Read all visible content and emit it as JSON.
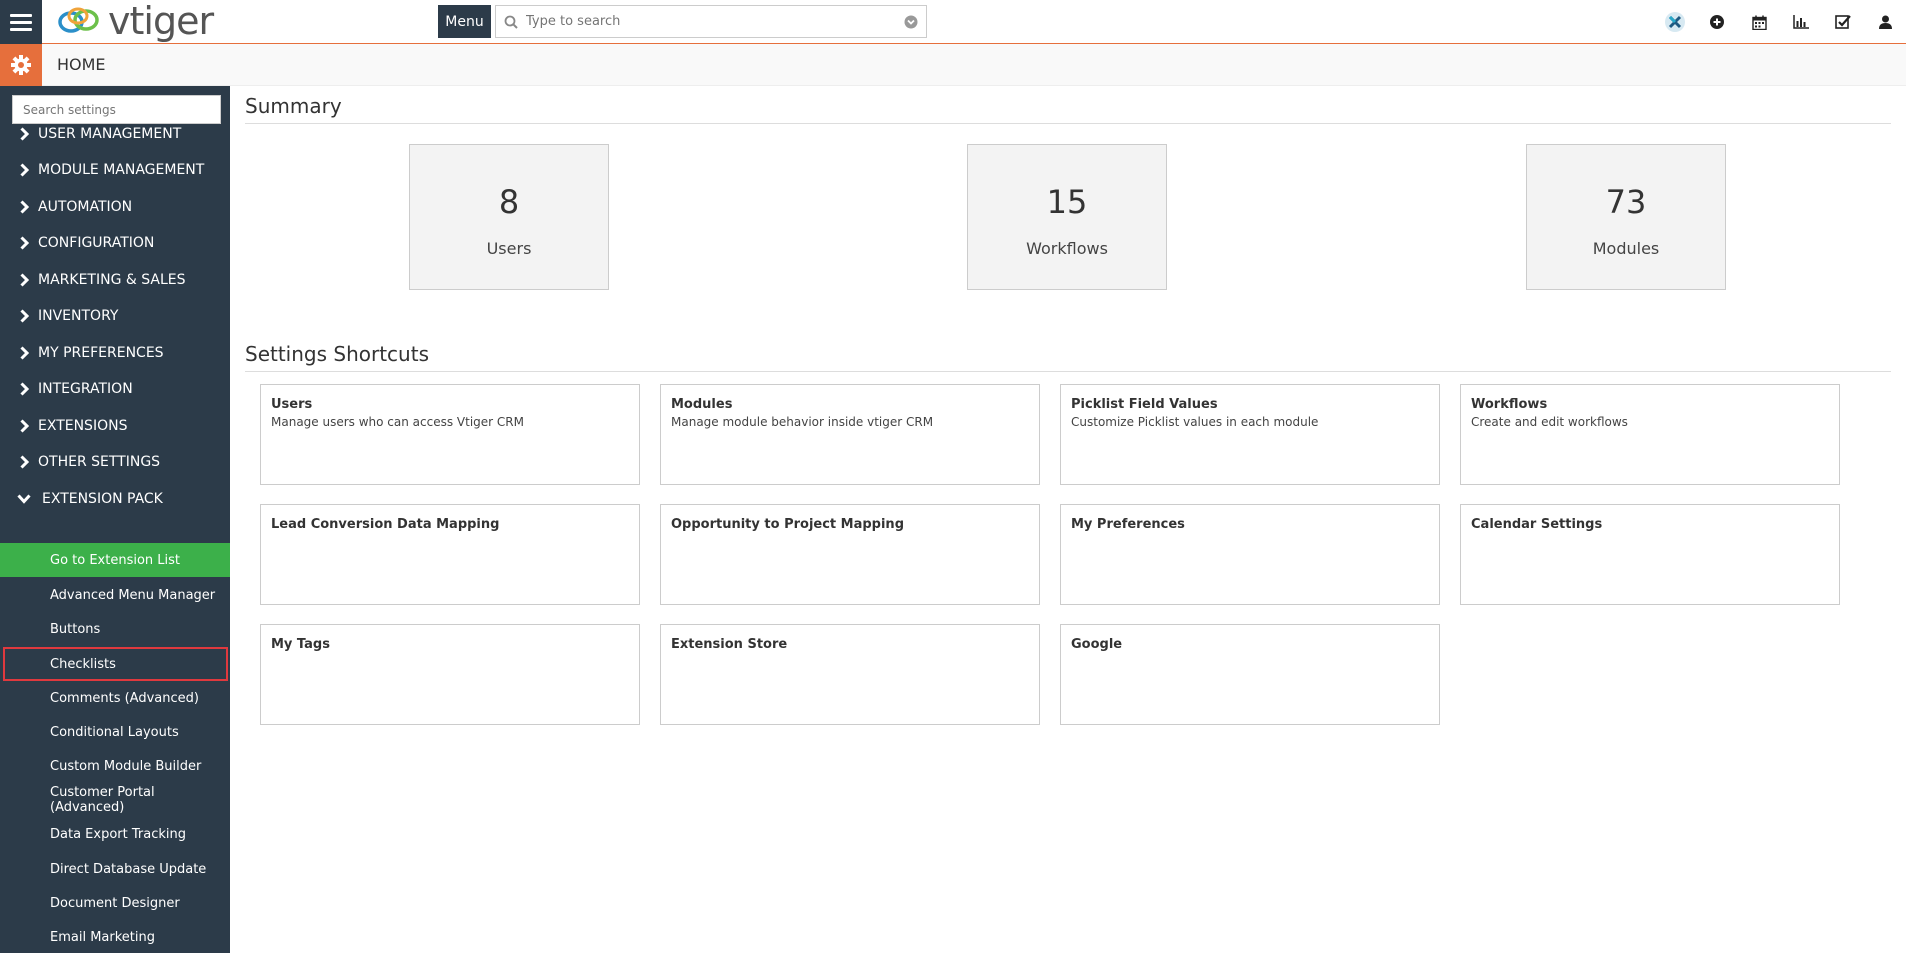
{
  "topbar": {
    "logo_text": "vtiger",
    "menu_label": "Menu",
    "search_placeholder": "Type to search",
    "icons": [
      "vtiger-x-icon",
      "plus-circle-icon",
      "calendar-icon",
      "chart-icon",
      "checkbox-icon",
      "user-icon"
    ]
  },
  "subbar": {
    "title": "HOME"
  },
  "sidebar": {
    "search_placeholder": "Search settings",
    "groups": [
      {
        "label": "USER MANAGEMENT"
      },
      {
        "label": "MODULE MANAGEMENT"
      },
      {
        "label": "AUTOMATION"
      },
      {
        "label": "CONFIGURATION"
      },
      {
        "label": "MARKETING & SALES"
      },
      {
        "label": "INVENTORY"
      },
      {
        "label": "MY PREFERENCES"
      },
      {
        "label": "INTEGRATION"
      },
      {
        "label": "EXTENSIONS"
      },
      {
        "label": "OTHER SETTINGS"
      },
      {
        "label": "EXTENSION PACK"
      }
    ],
    "extension_items": [
      {
        "label": "Go to Extension List"
      },
      {
        "label": "Advanced Menu Manager"
      },
      {
        "label": "Buttons"
      },
      {
        "label": "Checklists"
      },
      {
        "label": "Comments (Advanced)"
      },
      {
        "label": "Conditional Layouts"
      },
      {
        "label": "Custom Module Builder"
      },
      {
        "label": "Customer Portal (Advanced)"
      },
      {
        "label": "Data Export Tracking"
      },
      {
        "label": "Direct Database Update"
      },
      {
        "label": "Document Designer"
      },
      {
        "label": "Email Marketing"
      }
    ]
  },
  "summary": {
    "title": "Summary",
    "boxes": [
      {
        "value": "8",
        "label": "Users"
      },
      {
        "value": "15",
        "label": "Workflows"
      },
      {
        "value": "73",
        "label": "Modules"
      }
    ]
  },
  "shortcuts": {
    "title": "Settings Shortcuts",
    "cards": [
      {
        "title": "Users",
        "desc": "Manage users who can access Vtiger CRM"
      },
      {
        "title": "Modules",
        "desc": "Manage module behavior inside vtiger CRM"
      },
      {
        "title": "Picklist Field Values",
        "desc": "Customize Picklist values in each module"
      },
      {
        "title": "Workflows",
        "desc": "Create and edit workflows"
      },
      {
        "title": "Lead Conversion Data Mapping",
        "desc": ""
      },
      {
        "title": "Opportunity to Project Mapping",
        "desc": ""
      },
      {
        "title": "My Preferences",
        "desc": ""
      },
      {
        "title": "Calendar Settings",
        "desc": ""
      },
      {
        "title": "My Tags",
        "desc": ""
      },
      {
        "title": "Extension Store",
        "desc": ""
      },
      {
        "title": "Google",
        "desc": ""
      }
    ]
  },
  "colors": {
    "sidebar_bg": "#2c3b49",
    "accent_orange": "#e66f3c",
    "active_green": "#3cb04a",
    "highlight_red": "#e0393e"
  }
}
